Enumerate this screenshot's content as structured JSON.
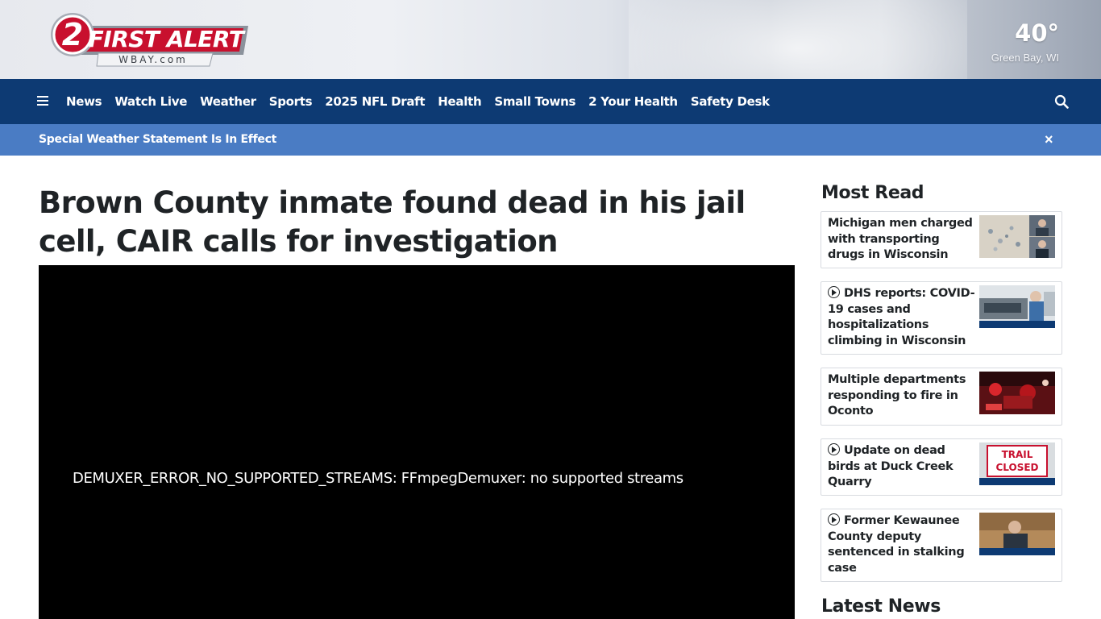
{
  "header": {
    "logo": {
      "number": "2",
      "brand": "FIRST ALERT",
      "site": "WBAY.com"
    },
    "weather": {
      "temperature": "40°",
      "location": "Green Bay, WI"
    }
  },
  "nav": {
    "items": [
      "News",
      "Watch Live",
      "Weather",
      "Sports",
      "2025 NFL Draft",
      "Health",
      "Small Towns",
      "2 Your Health",
      "Safety Desk"
    ]
  },
  "alert": {
    "text": "Special Weather Statement Is In Effect",
    "close": "×"
  },
  "article": {
    "headline": "Brown County inmate found dead in his jail cell, CAIR calls for investigation",
    "video_error": "DEMUXER_ERROR_NO_SUPPORTED_STREAMS: FFmpegDemuxer: no supported streams"
  },
  "sidebar": {
    "most_read_title": "Most Read",
    "latest_news_title": "Latest News",
    "items": [
      {
        "title": "Michigan men charged with transporting drugs in Wisconsin",
        "video": false
      },
      {
        "title": "DHS reports: COVID-19 cases and hospitalizations climbing in Wisconsin",
        "video": true
      },
      {
        "title": "Multiple departments responding to fire in Oconto",
        "video": false
      },
      {
        "title": "Update on dead birds at Duck Creek Quarry",
        "video": true
      },
      {
        "title": "Former Kewaunee County deputy sentenced in stalking case",
        "video": true
      }
    ],
    "thumb_sign_text": [
      "TRAIL",
      "CLOSED"
    ]
  },
  "colors": {
    "nav": "#0d3a73",
    "alert": "#4a7cc4",
    "logo_red": "#c8102e"
  }
}
